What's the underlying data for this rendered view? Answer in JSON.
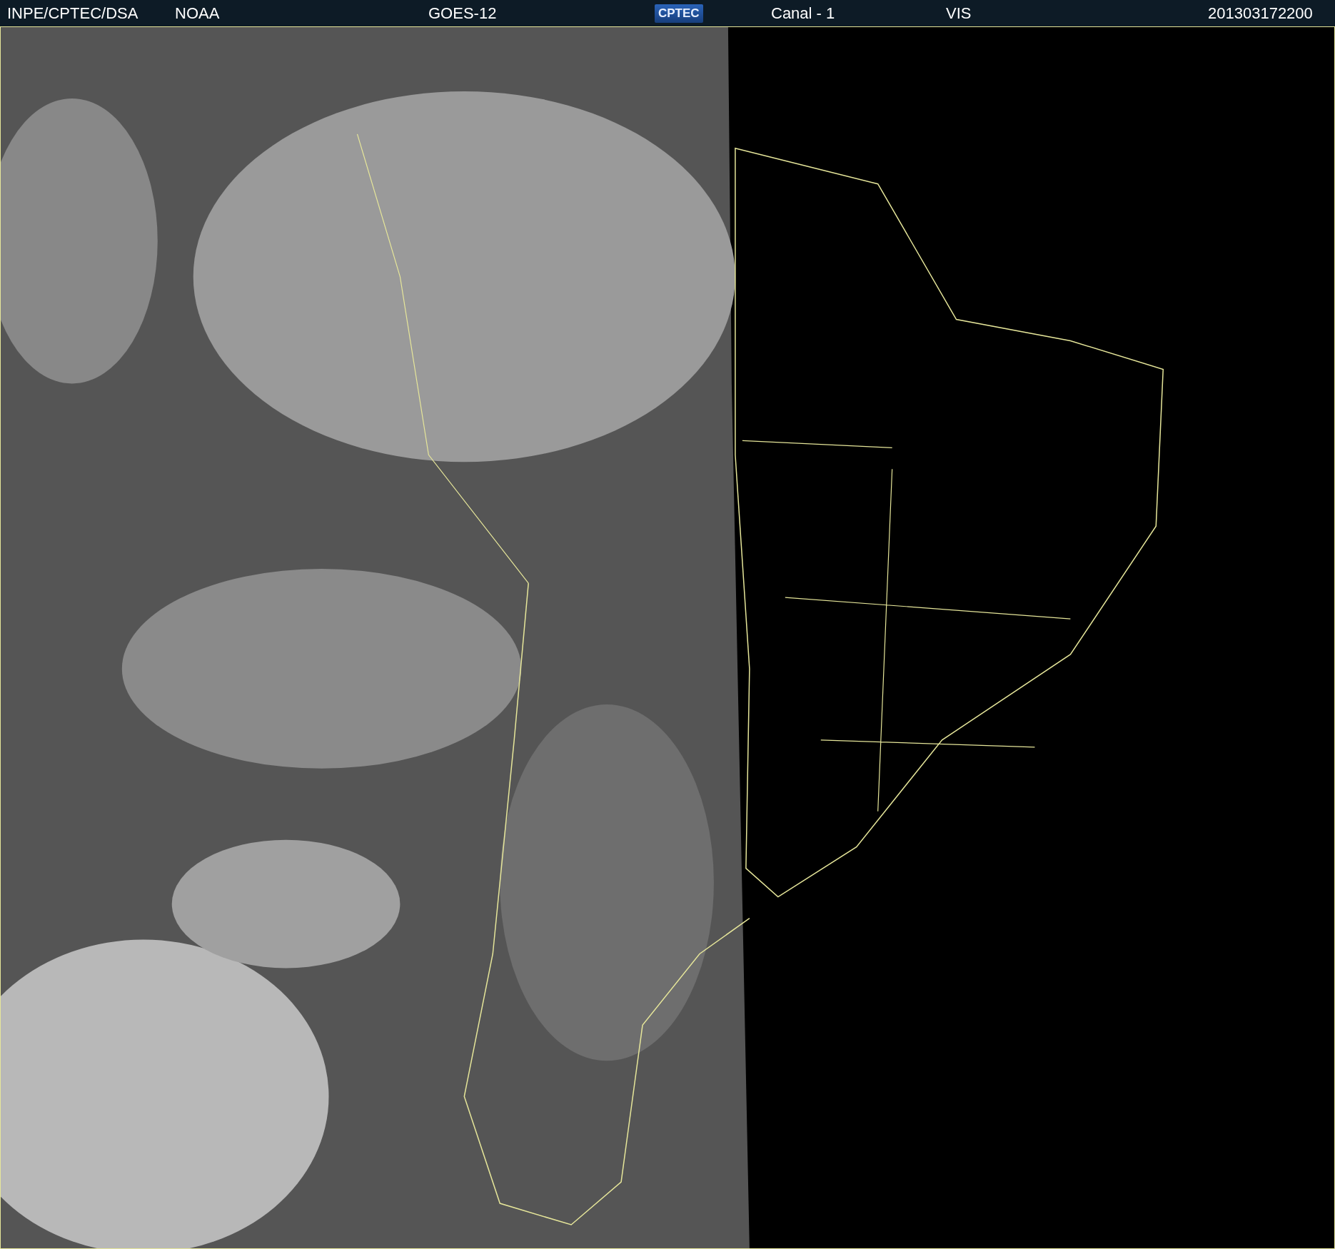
{
  "header": {
    "items": [
      {
        "kind": "text",
        "text": "INPE/CPTEC/DSA"
      },
      {
        "kind": "text",
        "text": "NOAA"
      },
      {
        "kind": "text",
        "text": "GOES-12"
      },
      {
        "kind": "logo",
        "text": "CPTEC"
      },
      {
        "kind": "text",
        "text": "Canal - 1"
      },
      {
        "kind": "text",
        "text": "VIS"
      },
      {
        "kind": "text",
        "text": "201303172200"
      }
    ]
  }
}
